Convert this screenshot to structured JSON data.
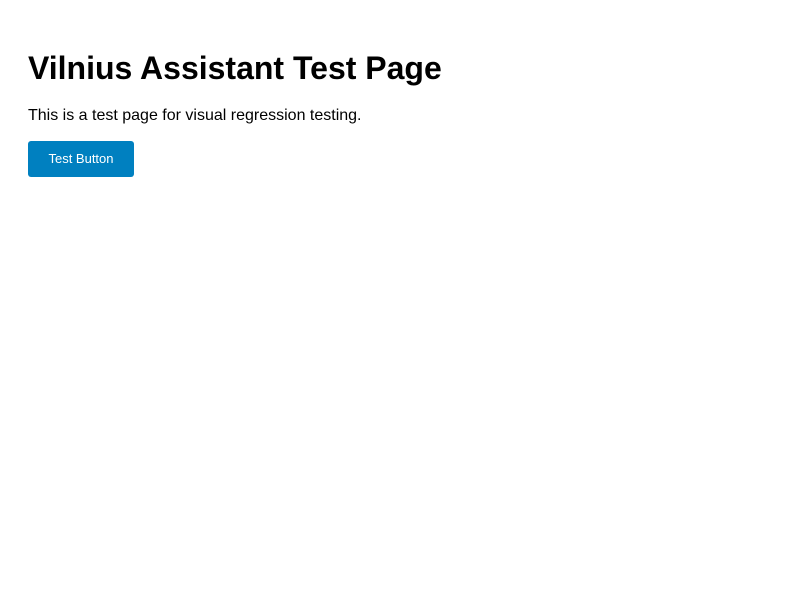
{
  "page": {
    "title": "Vilnius Assistant Test Page",
    "description": "This is a test page for visual regression testing.",
    "button_label": "Test Button"
  },
  "colors": {
    "background": "#ffffff",
    "text": "#000000",
    "button_bg": "#0080c0",
    "button_text": "#ffffff"
  }
}
